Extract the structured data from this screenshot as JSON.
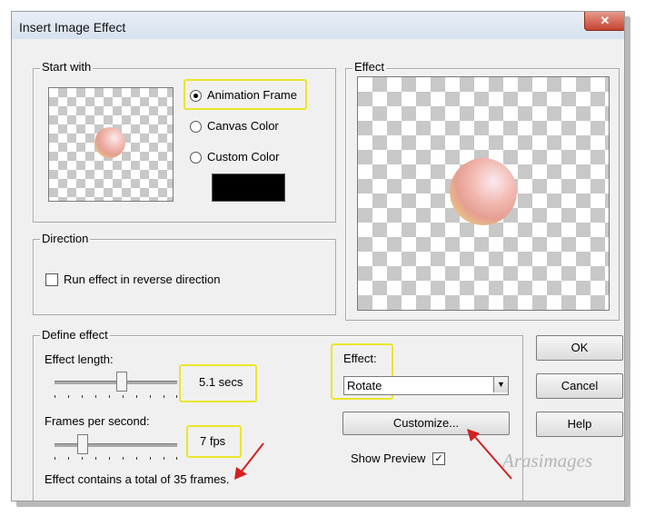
{
  "dialog": {
    "title": "Insert Image Effect"
  },
  "start_with": {
    "label": "Start with",
    "options": {
      "animation_frame": {
        "label": "Animation Frame",
        "selected": true
      },
      "canvas_color": {
        "label": "Canvas Color",
        "selected": false
      },
      "custom_color": {
        "label": "Custom Color",
        "selected": false,
        "swatch": "#000000"
      }
    }
  },
  "effect_preview": {
    "label": "Effect"
  },
  "direction": {
    "label": "Direction",
    "reverse": {
      "label": "Run effect in reverse direction",
      "checked": false
    }
  },
  "define_effect": {
    "label": "Define effect",
    "effect_length": {
      "label": "Effect length:",
      "value": "5.1 secs",
      "slider_fraction": 0.55
    },
    "fps": {
      "label": "Frames per second:",
      "value": "7 fps",
      "slider_fraction": 0.2
    },
    "effect_label": "Effect:",
    "effect_value": "Rotate",
    "customize_label": "Customize...",
    "show_preview_label": "Show Preview",
    "show_preview_checked": true,
    "total_text": "Effect contains a total of 35 frames."
  },
  "buttons": {
    "ok": "OK",
    "cancel": "Cancel",
    "help": "Help"
  },
  "watermark": "Arasimages",
  "colors": {
    "highlight": "#e9e62b",
    "arrow": "#d42020"
  }
}
